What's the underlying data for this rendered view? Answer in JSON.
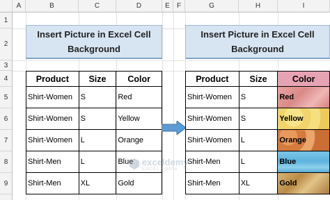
{
  "columns": [
    "A",
    "B",
    "C",
    "D",
    "E",
    "F",
    "G",
    "H",
    "I"
  ],
  "rows": [
    "1",
    "2",
    "3",
    "4",
    "5",
    "6",
    "7",
    "8",
    "9"
  ],
  "left_title": "Insert Picture in Excel Cell Background",
  "right_title": "Insert Picture in Excel Cell Background",
  "table_headers": {
    "product": "Product",
    "size": "Size",
    "color": "Color"
  },
  "left_rows": [
    {
      "product": "Shirt-Women",
      "size": "S",
      "color": "Red"
    },
    {
      "product": "Shirt-Women",
      "size": "S",
      "color": "Yellow"
    },
    {
      "product": "Shirt-Women",
      "size": "L",
      "color": "Orange"
    },
    {
      "product": "Shirt-Men",
      "size": "L",
      "color": "Blue"
    },
    {
      "product": "Shirt-Men",
      "size": "XL",
      "color": "Gold"
    }
  ],
  "right_rows": [
    {
      "product": "Shirt-Women",
      "size": "S",
      "color": "Red"
    },
    {
      "product": "Shirt-Women",
      "size": "S",
      "color": "Yellow"
    },
    {
      "product": "Shirt-Women",
      "size": "L",
      "color": "Orange"
    },
    {
      "product": "Shirt-Men",
      "size": "L",
      "color": "Blue"
    },
    {
      "product": "Shirt-Men",
      "size": "XL",
      "color": "Gold"
    }
  ],
  "watermark": {
    "name": "exceldemy",
    "sub": "EXCEL · DATA · BI"
  },
  "colors": {
    "title_bg": "#d7e4f2",
    "arrow": "#5b9bd5"
  },
  "icons": {
    "arrow": "right-arrow-icon",
    "watermark_logo": "exceldemy-logo-icon"
  }
}
